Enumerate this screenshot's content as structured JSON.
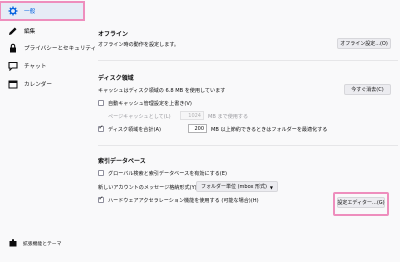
{
  "sidebar": {
    "items": [
      {
        "label": "一般",
        "icon": "gear-icon"
      },
      {
        "label": "編集",
        "icon": "pencil-icon"
      },
      {
        "label": "プライバシーとセキュリティ",
        "icon": "lock-icon"
      },
      {
        "label": "チャット",
        "icon": "chat-bubble-icon"
      },
      {
        "label": "カレンダー",
        "icon": "calendar-icon"
      }
    ],
    "extensions_label": "拡張機能とテーマ"
  },
  "offline": {
    "heading": "オフライン",
    "description": "オフライン時の動作を設定します。",
    "button": "オフライン設定...(O)"
  },
  "disk": {
    "heading": "ディスク領域",
    "usage_text": "キャッシュはディスク領域の 6.8 MB を使用しています",
    "clear_button": "今すぐ消去(C)",
    "override_cache_label": "自動キャッシュ管理設定を上書き(V)",
    "cache_limit_label": "ページキャッシュとして(L)",
    "cache_limit_value": "1024",
    "cache_limit_unit": "MB まで使用する",
    "compact_label": "ディスク領域を合計(A)",
    "compact_value": "200",
    "compact_suffix": "MB 以上節約できるときはフォルダーを最適化する"
  },
  "index": {
    "heading": "索引データベース",
    "global_search_label": "グローバル検索と索引データベースを有効にする(E)",
    "storage_label": "新しいアカウントのメッセージ格納形式(Y):",
    "storage_value": "フォルダー単位 (mbox 形式)",
    "hw_accel_label": "ハードウェアアクセラレーション機能を使用する (可能な場合)(H)"
  },
  "config_editor_button": "設定エディター...(G)",
  "colors": {
    "accent": "#0060df",
    "highlight": "#ee8ebd"
  }
}
